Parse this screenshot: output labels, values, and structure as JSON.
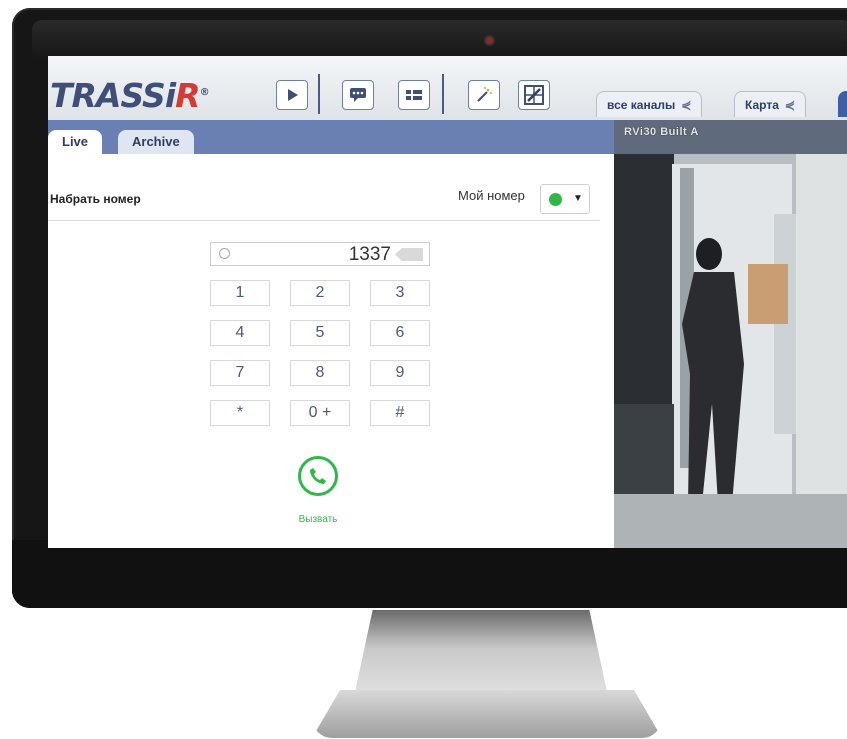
{
  "app": {
    "logo_text_a": "TRASSi",
    "logo_text_b": "R",
    "logo_mark": "®"
  },
  "toolbar": {
    "buttons": [
      {
        "icon": "play-icon"
      },
      {
        "icon": "chat-icon"
      },
      {
        "icon": "layout-icon"
      },
      {
        "icon": "magic-wand-icon"
      },
      {
        "icon": "settings-grid-icon"
      }
    ]
  },
  "top_tabs": [
    {
      "label": "все каналы",
      "icon": "share-icon"
    },
    {
      "label": "Карта",
      "icon": "share-icon"
    }
  ],
  "left_tabs": {
    "live": "Live",
    "archive": "Archive"
  },
  "dialer": {
    "title": "Набрать номер",
    "my_number_label": "Мой номер",
    "status_color": "#2fb84a",
    "number": "1337",
    "keys": [
      "1",
      "2",
      "3",
      "4",
      "5",
      "6",
      "7",
      "8",
      "9",
      "*",
      "0 +",
      "#"
    ],
    "call_label": "Вызвать"
  },
  "video": {
    "camera_name": "RVi30 Built A"
  },
  "colors": {
    "accent_blue": "#3e5fa3",
    "tab_strip": "#6a7fb2",
    "call_green": "#2fb84a",
    "logo_red": "#d63a36",
    "logo_blue": "#3f4f78"
  }
}
